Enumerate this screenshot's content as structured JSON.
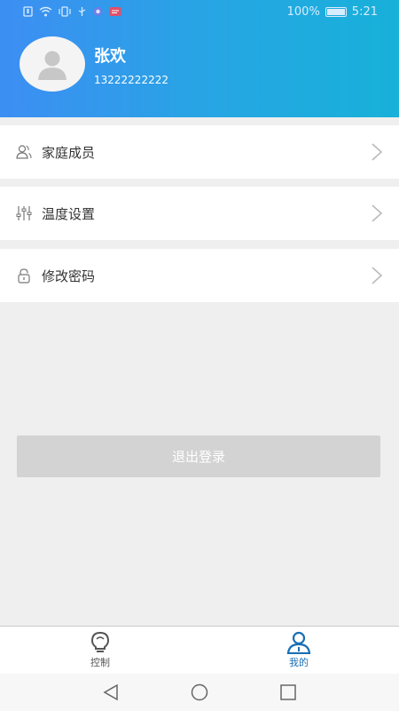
{
  "status_bar": {
    "battery": "100%",
    "time": "5:21"
  },
  "profile": {
    "name": "张欢",
    "phone": "13222222222"
  },
  "menu": [
    {
      "label": "家庭成员",
      "icon": "family-icon"
    },
    {
      "label": "温度设置",
      "icon": "sliders-icon"
    },
    {
      "label": "修改密码",
      "icon": "lock-icon"
    }
  ],
  "logout_label": "退出登录",
  "tabs": [
    {
      "label": "控制",
      "icon": "bulb-icon",
      "active": false
    },
    {
      "label": "我的",
      "icon": "person-icon",
      "active": true
    }
  ],
  "colors": {
    "header_start": "#3d8ef3",
    "header_end": "#17b1d9",
    "active_tab": "#1a6fb5",
    "inactive_tab": "#555555",
    "logout_bg": "#d3d3d3"
  }
}
